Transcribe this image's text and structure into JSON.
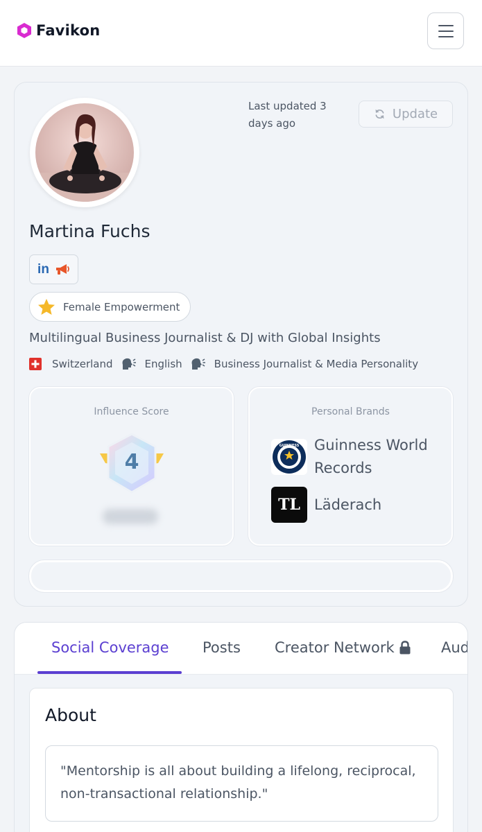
{
  "header": {
    "brand": "Favikon",
    "menu_icon": "hamburger-icon"
  },
  "profile": {
    "last_updated": "Last updated 3 days ago",
    "update_label": "Update",
    "name": "Martina Fuchs",
    "socials": [
      "linkedin-icon",
      "megaphone-icon"
    ],
    "tag": "Female Empowerment",
    "headline": "Multilingual Business Journalist & DJ with Global Insights",
    "country": "Switzerland",
    "language": "English",
    "category": "Business Journalist & Media Personality"
  },
  "influence": {
    "title": "Influence Score",
    "level": "4"
  },
  "brands": {
    "title": "Personal Brands",
    "items": [
      {
        "name": "Guinness World Records",
        "logo_text": "GUINNESS"
      },
      {
        "name": "Läderach",
        "logo_text": "TL"
      }
    ]
  },
  "tabs": {
    "items": [
      "Social Coverage",
      "Posts",
      "Creator Network",
      "Audie"
    ],
    "active": "Social Coverage"
  },
  "about": {
    "title": "About",
    "quote": "\"Mentorship is all about building a lifelong, reciprocal, non-transactional relationship.\""
  },
  "colors": {
    "accent": "#5b3fd1",
    "brand_logo": "#d92bd0",
    "linkedin": "#2867b2",
    "megaphone": "#e8562a"
  }
}
